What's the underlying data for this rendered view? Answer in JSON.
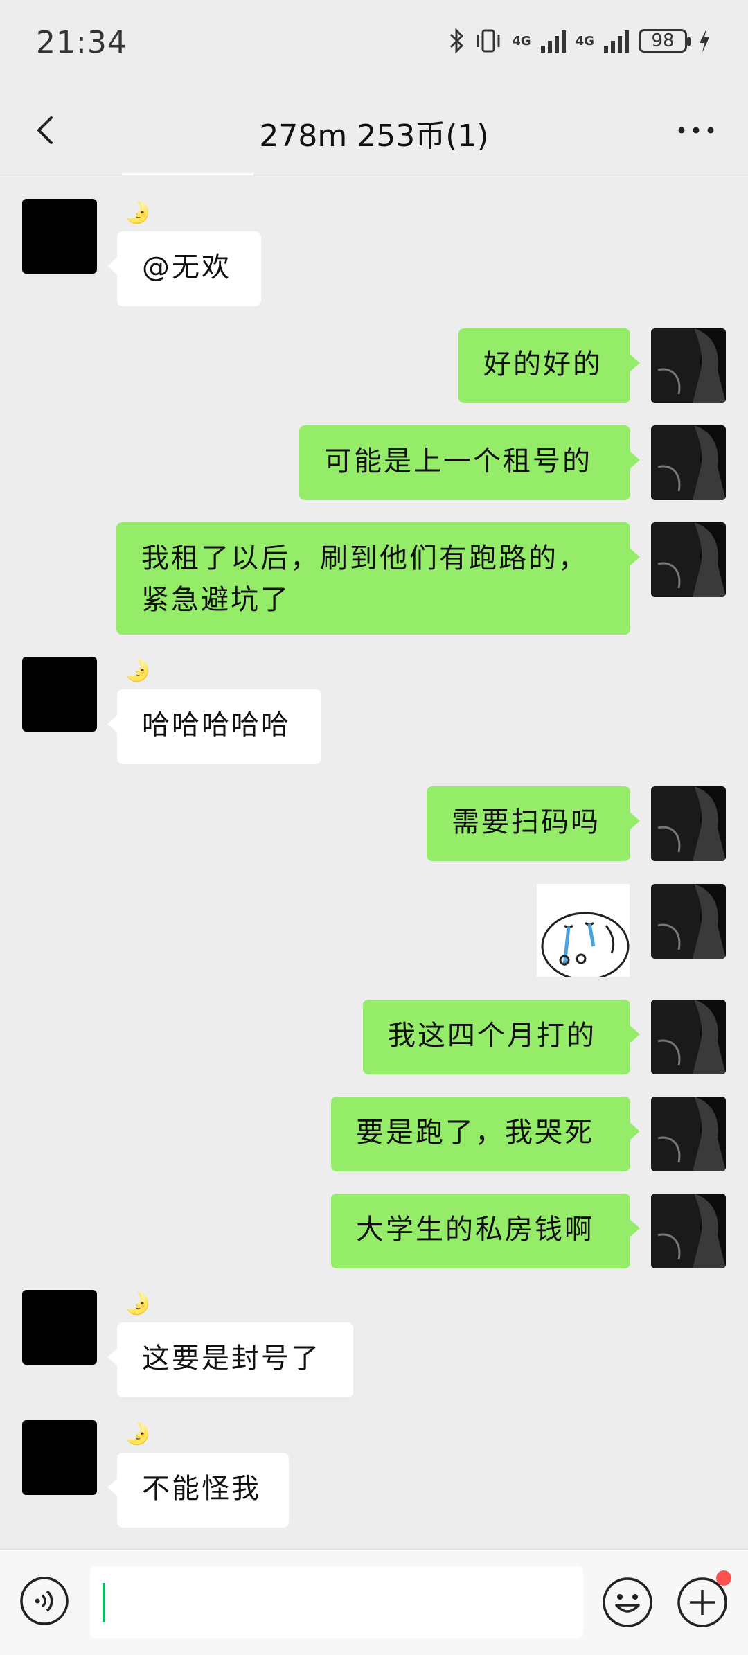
{
  "status_bar": {
    "time": "21:34",
    "network_1": "4G",
    "network_2": "4G",
    "battery": "98"
  },
  "header": {
    "title": "278m 253币(1)"
  },
  "messages": [
    {
      "side": "left",
      "text": "@无欢"
    },
    {
      "side": "right",
      "text": "好的好的"
    },
    {
      "side": "right",
      "text": "可能是上一个租号的"
    },
    {
      "side": "right",
      "text": "我租了以后，刷到他们有跑路的，紧急避坑了"
    },
    {
      "side": "left",
      "text": "哈哈哈哈哈"
    },
    {
      "side": "right",
      "text": "需要扫码吗"
    },
    {
      "side": "right",
      "type": "sticker"
    },
    {
      "side": "right",
      "text": "我这四个月打的"
    },
    {
      "side": "right",
      "text": "要是跑了，我哭死"
    },
    {
      "side": "right",
      "text": "大学生的私房钱啊"
    },
    {
      "side": "left",
      "text": "这要是封号了"
    },
    {
      "side": "left",
      "text": "不能怪我"
    }
  ],
  "sender_badge": "🌛",
  "input": {
    "value": ""
  },
  "colors": {
    "my_bubble": "#95ec69",
    "their_bubble": "#ffffff",
    "background": "#ededed",
    "cursor": "#07c160"
  },
  "icons": [
    "back-arrow-icon",
    "more-icon",
    "voice-icon",
    "emoji-icon",
    "plus-icon",
    "bluetooth-icon",
    "vibrate-icon"
  ]
}
